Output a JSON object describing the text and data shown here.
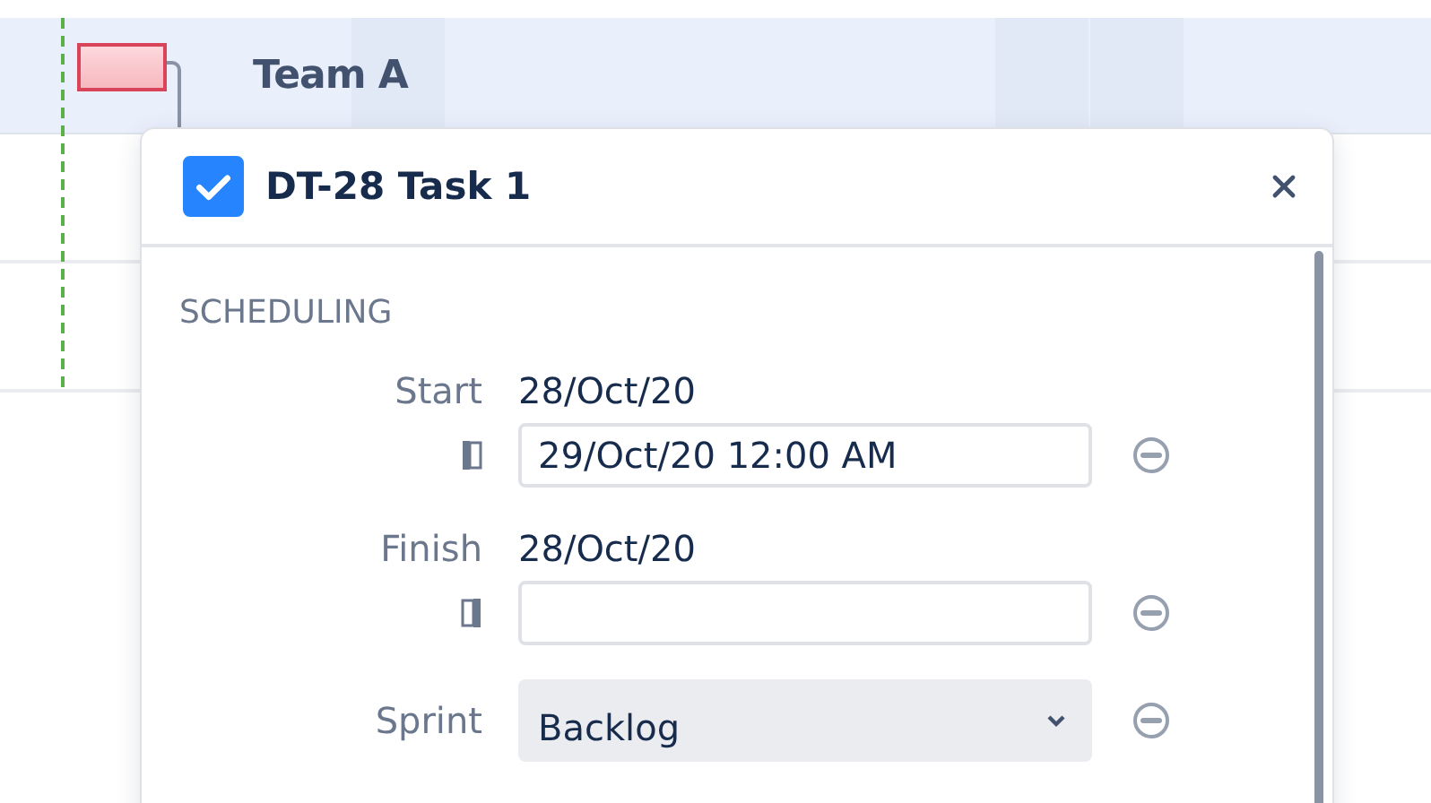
{
  "timeline": {
    "row_label": "Team A"
  },
  "popup": {
    "title": "DT-28 Task 1",
    "checked": true,
    "section": "SCHEDULING",
    "fields": [
      {
        "kind": "start_date",
        "label": "Start",
        "value": "28/Oct/20",
        "input_value": "29/Oct/20 12:00 AM"
      },
      {
        "kind": "end_date",
        "label": "Finish",
        "value": "28/Oct/20"
      },
      {
        "kind": "select",
        "label": "Sprint",
        "value": "Backlog"
      }
    ]
  }
}
